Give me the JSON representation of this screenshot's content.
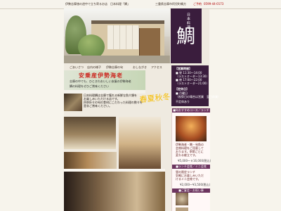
{
  "top": {
    "left_text": "伊勢志摩旅の途中で立ち寄るお店　日本料理「鯛」",
    "right_text": "三重県志摩市阿児町鵜方",
    "phone_prefix": "ご予約",
    "phone": "0599-44-0173"
  },
  "header": {
    "small_title": "日本料理",
    "main_title": "鯛"
  },
  "nav": {
    "items": [
      "ごあいさつ",
      "店内の様子",
      "伊勢志摩の旬",
      "おしながき",
      "アクセス"
    ]
  },
  "hours": {
    "heading": "【営業時間】",
    "lines": [
      "■ 昼 11:30〜14:00",
      "（ラストオーダー13:30）",
      "■ 夜 17:00〜22:00",
      "（ラストオーダー21:00）"
    ],
    "holiday_heading": "【定休日】",
    "holiday_lines": [
      "■ 月曜日",
      "（祝祭日の場合は営業　翌日休業）"
    ],
    "note": "不定休あり"
  },
  "banner": {
    "title": "安乗産伊勢海老",
    "lines": [
      "志摩の中でも、ひときわおいしい安乗の伊勢海老",
      "鯛の料理をぜひご賞味ください"
    ]
  },
  "intro": {
    "lines": [
      "日本料理鯛は志摩で獲れる新鮮な魚介類を",
      "お楽しみいただける店です。",
      "四季折々の旬の食材にこだわった料理の数々を",
      "是非ご賞味ください。"
    ],
    "seasonal": "春夏秋冬"
  },
  "sidebar": {
    "header1": "■旬おすすめコース／ランチ料理",
    "box1_lines": [
      "伊勢海老・鮑・旬魚の",
      "会席料理をご用意して",
      "おります。季節ごとに",
      "変わる献立です。"
    ],
    "price1": "¥5,000〜￥16,000(税込)",
    "header2": "■ランチ会席／ミニ会席",
    "box2_lines": [
      "昼の限定ランチ",
      "気軽にお楽しみいただ",
      "けるミニ会席です。"
    ],
    "price2": "¥2,000〜¥3,500(税込)",
    "header3": "■ご宴会・お祝い事"
  },
  "colors": {
    "purple": "#3a1d3d",
    "banner_red": "#cc2a22",
    "seasonal_gold": "#f6bd00"
  }
}
